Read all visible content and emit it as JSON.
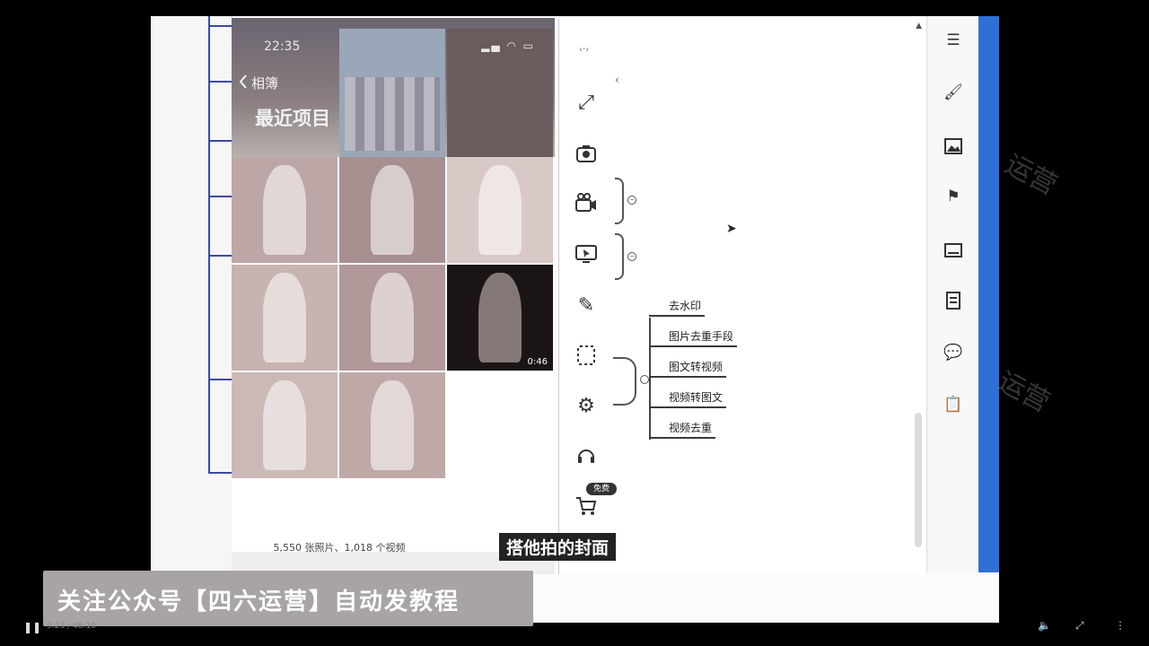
{
  "phone": {
    "status_time": "22:35",
    "status_icons": "▂▄ ◠ ▭",
    "back_label": "相簿",
    "album_title": "最近项目",
    "thumbnails": [
      {
        "duration": ""
      },
      {
        "duration": ""
      },
      {
        "duration": ""
      },
      {
        "duration": ""
      },
      {
        "duration": ""
      },
      {
        "duration": "0:46"
      },
      {
        "duration": ""
      },
      {
        "duration": ""
      }
    ],
    "photo_count": "5,550 张照片、1,018 个视频"
  },
  "panel": {
    "dots": "‹·›",
    "chevron": "‹",
    "cart_badge": "免费",
    "menu_items": [
      "去水印",
      "图片去重手段",
      "图文转视频",
      "视频转图文",
      "视频去重"
    ]
  },
  "watermark": "运营",
  "subtitle": "搭他拍的封面",
  "banner": "关注公众号【四六运营】自动发教程",
  "player": {
    "time": "9:23 / 48:10"
  },
  "colors": {
    "accent_blue": "#2f6fd6",
    "mindmap_line": "#3b4aa0",
    "banner_bg": "#a8a4a6"
  },
  "icons": {
    "tools": [
      "expand-icon",
      "camera-icon",
      "video-camera-icon",
      "screen-share-icon",
      "brush-icon",
      "dashed-frame-icon",
      "settings-icon",
      "headset-icon",
      "cart-icon"
    ],
    "rail": [
      "list-settings-icon",
      "broom-icon",
      "image-icon",
      "flag-icon",
      "card-icon",
      "document-icon",
      "chat-icon",
      "clipboard-icon"
    ]
  }
}
